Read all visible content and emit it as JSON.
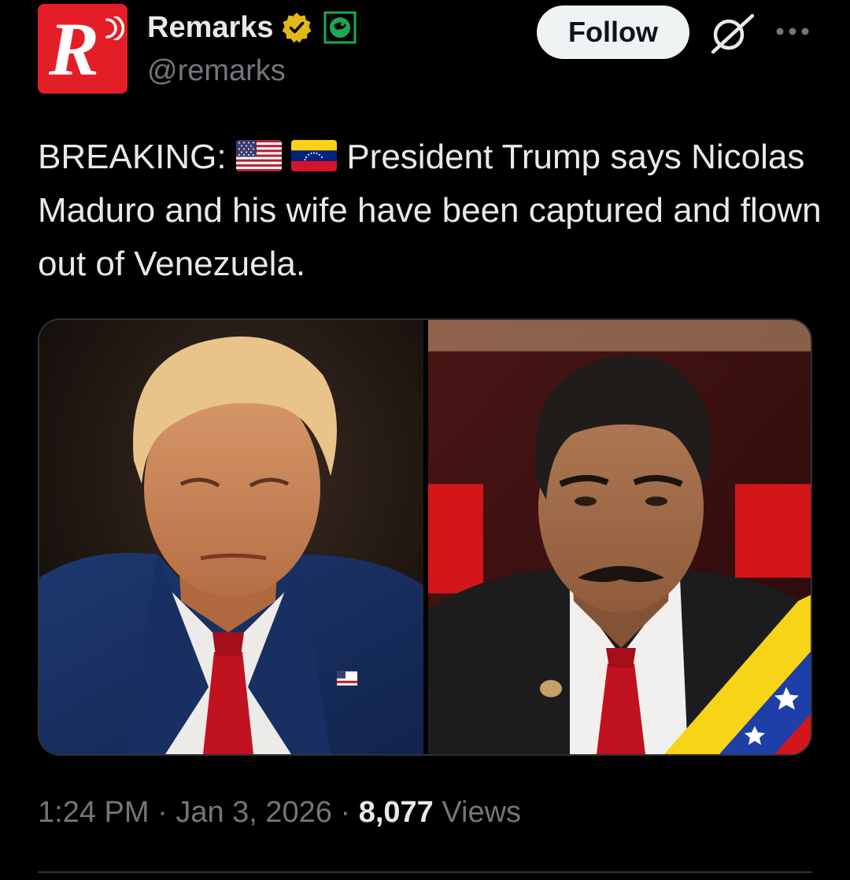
{
  "account": {
    "display_name": "Remarks",
    "handle": "@remarks",
    "avatar_letter": "R",
    "brand_color": "#e41e26",
    "verified_badge_color": "#e2b719",
    "affiliate_badge_color": "#1da84f"
  },
  "actions": {
    "follow_label": "Follow"
  },
  "icons": {
    "grok": "grok-icon",
    "more": "more-icon",
    "verified": "verified-badge-icon",
    "affiliate": "affiliate-badge-icon",
    "flag_us": "us-flag-icon",
    "flag_venezuela": "venezuela-flag-icon"
  },
  "tweet": {
    "prefix": "BREAKING:",
    "text_line1": "President Trump says",
    "text_rest": "Nicolas Maduro and his wife have been captured and flown out of Venezuela."
  },
  "meta": {
    "time": "1:24 PM",
    "separator": "·",
    "date": "Jan 3, 2026",
    "views_count": "8,077",
    "views_label": "Views"
  },
  "colors": {
    "background": "#000000",
    "text_primary": "#e7e9ea",
    "text_secondary": "#71767b",
    "border": "#2f3336"
  }
}
